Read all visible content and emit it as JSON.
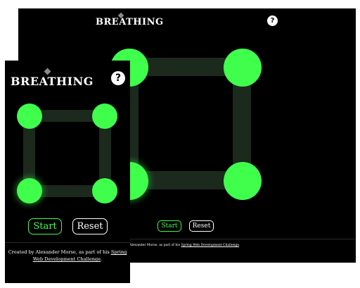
{
  "app": {
    "title": "BREATHING",
    "help_label": "?",
    "start_label": "Start",
    "reset_label": "Reset",
    "credit_prefix": "Created by Alexander Morse, as part of his ",
    "credit_link": "Spring Web Development Challenge",
    "credit_suffix": ".",
    "desktop_credit_prefix": "ated by Alexander Morse, as part of his ",
    "accent_color": "#3fff4c",
    "background_color": "#000000",
    "track_color": "#1b2a1d"
  }
}
